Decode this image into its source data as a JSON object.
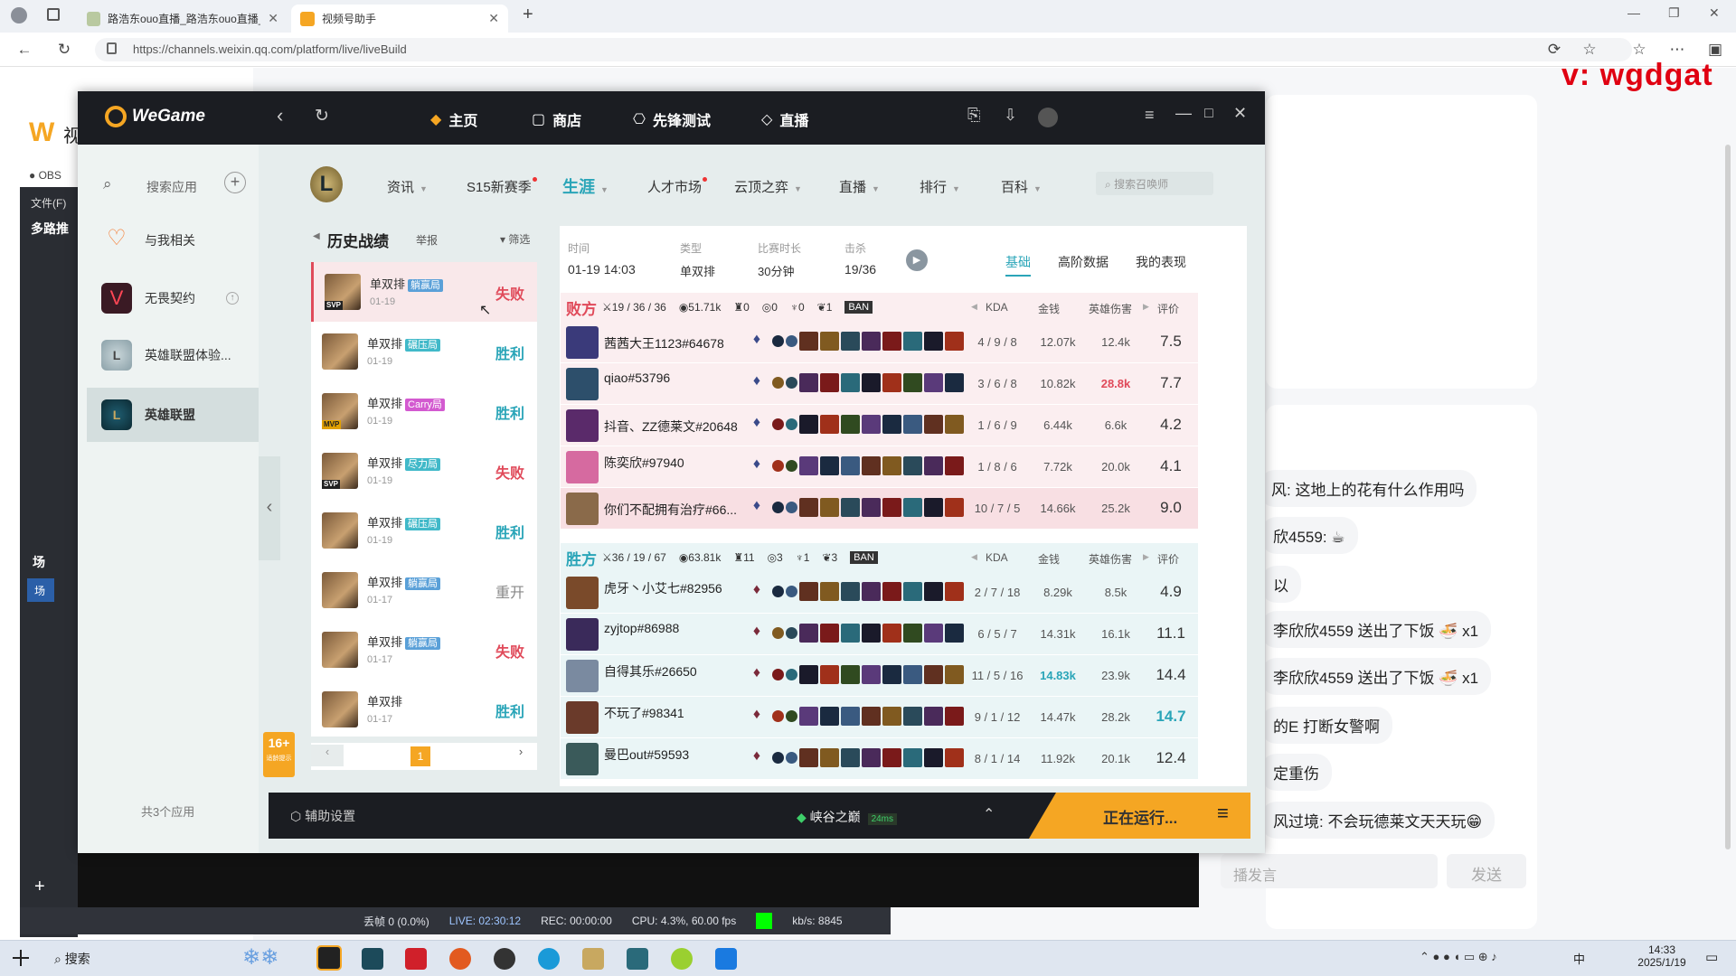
{
  "browser": {
    "tabs": [
      {
        "label": "路浩东ouo直播_路浩东ouo直播_..."
      },
      {
        "label": "视频号助手"
      }
    ],
    "url": "https://channels.weixin.qq.com/platform/live/liveBuild"
  },
  "watermark": "v:  wgdgat",
  "page": {
    "logo_text": "视",
    "chat": [
      {
        "text": "风: 这地上的花有什么作用吗"
      },
      {
        "text": "欣4559: ☕"
      },
      {
        "text": "以"
      },
      {
        "text": "李欣欣4559 送出了下饭 🍜 x1"
      },
      {
        "text": "李欣欣4559 送出了下饭 🍜 x1"
      },
      {
        "text": "的E 打断女警啊"
      },
      {
        "text": "定重伤"
      },
      {
        "text": "风过境: 不会玩德莱文天天玩😁"
      }
    ],
    "input_placeholder": "播发言",
    "send_label": "发送"
  },
  "obs": {
    "tab_label": "OBS",
    "file_menu": "文件(F)",
    "panel_title": "多路推",
    "scene_label": "场",
    "scene_item": "场",
    "status": {
      "dropped": "丢帧 0 (0.0%)",
      "live": "LIVE: 02:30:12",
      "rec": "REC: 00:00:00",
      "cpu": "CPU: 4.3%, 60.00 fps",
      "kbs": "kb/s: 8845"
    }
  },
  "wegame": {
    "logo": "WeGame",
    "nav": [
      {
        "label": "主页"
      },
      {
        "label": "商店"
      },
      {
        "label": "先锋测试"
      },
      {
        "label": "直播"
      }
    ],
    "sidebar": {
      "search_placeholder": "搜索应用",
      "items": [
        {
          "label": "与我相关"
        },
        {
          "label": "无畏契约"
        },
        {
          "label": "英雄联盟体验..."
        },
        {
          "label": "英雄联盟"
        }
      ],
      "footer": "共3个应用"
    },
    "lol_nav": [
      {
        "label": "资讯"
      },
      {
        "label": "S15新赛季"
      },
      {
        "label": "生涯"
      },
      {
        "label": "人才市场"
      },
      {
        "label": "云顶之弈"
      },
      {
        "label": "直播"
      },
      {
        "label": "排行"
      },
      {
        "label": "百科"
      }
    ],
    "lol_search_placeholder": "搜索召唤师",
    "history": {
      "title": "历史战绩",
      "report": "举报",
      "filter": "筛选",
      "rows": [
        {
          "mode": "单双排",
          "tag": "躺赢局",
          "tag_color": "#5aa0d8",
          "date": "01-19",
          "result": "失败",
          "badge": "SVP"
        },
        {
          "mode": "单双排",
          "tag": "碾压局",
          "tag_color": "#41b9c9",
          "date": "01-19",
          "result": "胜利",
          "badge": ""
        },
        {
          "mode": "单双排",
          "tag": "Carry局",
          "tag_color": "#d35ad0",
          "date": "01-19",
          "result": "胜利",
          "badge": "MVP"
        },
        {
          "mode": "单双排",
          "tag": "尽力局",
          "tag_color": "#41b9c9",
          "date": "01-19",
          "result": "失败",
          "badge": "SVP"
        },
        {
          "mode": "单双排",
          "tag": "碾压局",
          "tag_color": "#41b9c9",
          "date": "01-19",
          "result": "胜利",
          "badge": ""
        },
        {
          "mode": "单双排",
          "tag": "躺赢局",
          "tag_color": "#5aa0d8",
          "date": "01-17",
          "result": "重开",
          "badge": ""
        },
        {
          "mode": "单双排",
          "tag": "躺赢局",
          "tag_color": "#5aa0d8",
          "date": "01-17",
          "result": "失败",
          "badge": ""
        },
        {
          "mode": "单双排",
          "tag": "",
          "tag_color": "#5aa0d8",
          "date": "01-17",
          "result": "胜利",
          "badge": ""
        }
      ],
      "page": "1",
      "age_badge": "16+",
      "age_text": "适龄提示"
    },
    "match": {
      "time_label": "时间",
      "time": "01-19 14:03",
      "type_label": "类型",
      "type": "单双排",
      "duration_label": "比赛时长",
      "duration": "30分钟",
      "kills_label": "击杀",
      "kills": "19/36",
      "tabs": [
        {
          "label": "基础"
        },
        {
          "label": "高阶数据"
        },
        {
          "label": "我的表现"
        }
      ]
    },
    "losers": {
      "label": "败方",
      "kda": "19 / 36 / 36",
      "gold": "51.71k",
      "towers": "0",
      "dragons": "0",
      "barons": "0",
      "heralds": "1",
      "ban": "BAN",
      "players": [
        {
          "name": "茜茜大王1123#64678",
          "kda": "4 / 9 / 8",
          "gold": "12.07k",
          "dmg": "12.4k",
          "score": "7.5",
          "color": "#3a3a7a"
        },
        {
          "name": "qiao#53796",
          "kda": "3 / 6 / 8",
          "gold": "10.82k",
          "dmg": "28.8k",
          "score": "7.7",
          "color": "#2d4f6b"
        },
        {
          "name": "抖音、ZZ德莱文#20648",
          "kda": "1 / 6 / 9",
          "gold": "6.44k",
          "dmg": "6.6k",
          "score": "4.2",
          "color": "#5a2a6a"
        },
        {
          "name": "陈奕欣#97940",
          "kda": "1 / 8 / 6",
          "gold": "7.72k",
          "dmg": "20.0k",
          "score": "4.1",
          "color": "#d66aa0"
        },
        {
          "name": "你们不配拥有治疗#66...",
          "kda": "10 / 7 / 5",
          "gold": "14.66k",
          "dmg": "25.2k",
          "score": "9.0",
          "color": "#8a6a4a"
        }
      ]
    },
    "winners": {
      "label": "胜方",
      "kda": "36 / 19 / 67",
      "gold": "63.81k",
      "towers": "11",
      "dragons": "3",
      "barons": "1",
      "heralds": "3",
      "ban": "BAN",
      "players": [
        {
          "name": "虎牙丶小艾七#82956",
          "kda": "2 / 7 / 18",
          "gold": "8.29k",
          "dmg": "8.5k",
          "score": "4.9",
          "color": "#7a4a2a"
        },
        {
          "name": "zyjtop#86988",
          "kda": "6 / 5 / 7",
          "gold": "14.31k",
          "dmg": "16.1k",
          "score": "11.1",
          "color": "#3a2a5a"
        },
        {
          "name": "自得其乐#26650",
          "kda": "11 / 5 / 16",
          "gold": "14.83k",
          "dmg": "23.9k",
          "score": "14.4",
          "color": "#7a8aa0"
        },
        {
          "name": "不玩了#98341",
          "kda": "9 / 1 / 12",
          "gold": "14.47k",
          "dmg": "28.2k",
          "score": "14.7",
          "color": "#6a3a2a"
        },
        {
          "name": "曼巴out#59593",
          "kda": "8 / 1 / 14",
          "gold": "11.92k",
          "dmg": "20.1k",
          "score": "12.4",
          "color": "#3a5a5a"
        }
      ]
    },
    "columns": {
      "kda": "KDA",
      "gold": "金钱",
      "dmg": "英雄伤害",
      "score": "评价"
    },
    "bottom": {
      "assist": "辅助设置",
      "server": "峡谷之巅",
      "ping": "24ms",
      "running": "正在运行..."
    }
  },
  "taskbar": {
    "search": "搜索",
    "time": "14:33",
    "date": "2025/1/19",
    "ime": "中"
  }
}
